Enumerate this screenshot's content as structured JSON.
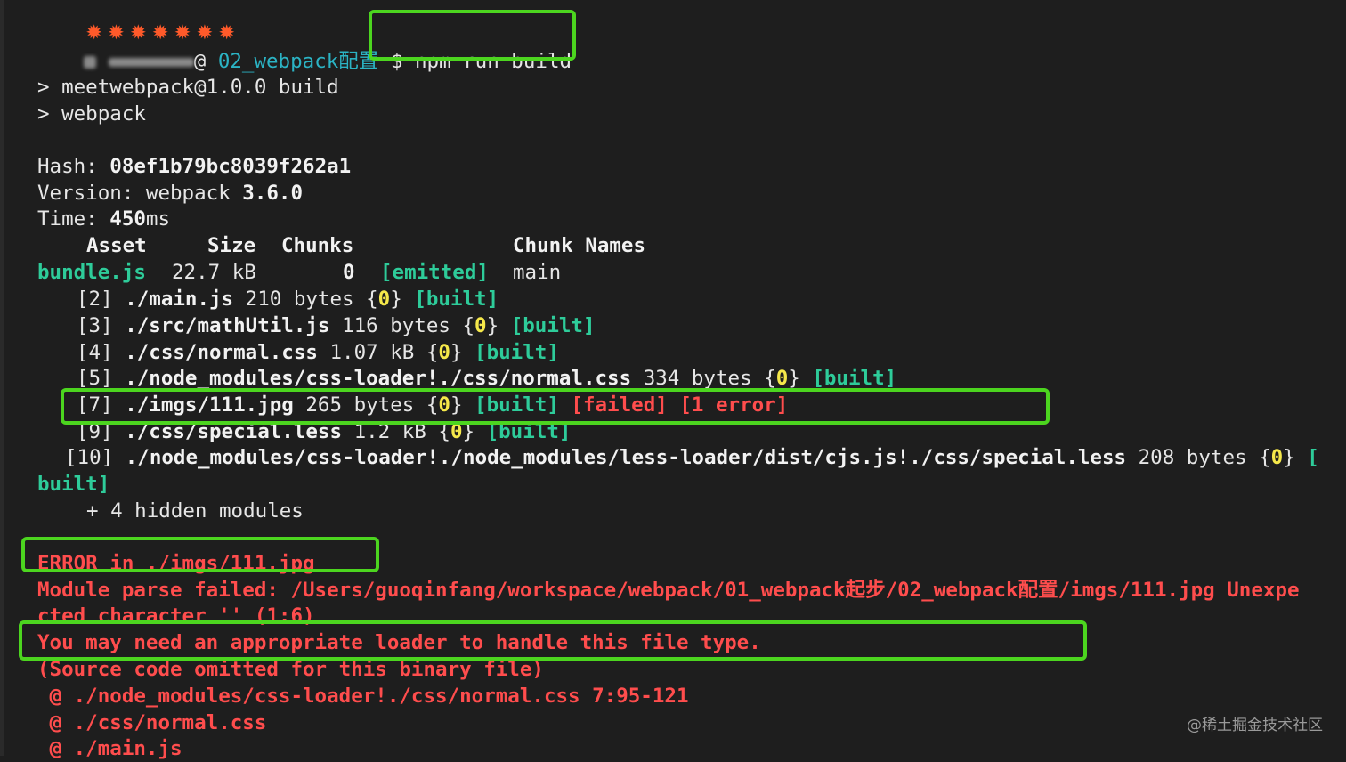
{
  "prompt": {
    "stars": "✹✹✹✹✹✹✹",
    "user_suffix": "@",
    "dir": "02_webpack配置",
    "symbol": "$",
    "command": "npm run build"
  },
  "script_lines": [
    "> meetwebpack@1.0.0 build",
    "> webpack"
  ],
  "summary": {
    "hash_label": "Hash: ",
    "hash": "08ef1b79bc8039f262a1",
    "version_label": "Version: webpack ",
    "version": "3.6.0",
    "time_label": "Time: ",
    "time": "450",
    "time_unit": "ms"
  },
  "asset_table": {
    "headers": [
      "Asset",
      "Size",
      "Chunks",
      "Chunk Names"
    ],
    "row": {
      "asset": "bundle.js",
      "size": "22.7 kB",
      "chunks": "0",
      "status": "[emitted]",
      "name": "main"
    }
  },
  "modules": [
    {
      "id": "[2]",
      "path": "./main.js",
      "size": "210 bytes",
      "chunk": "0",
      "status": "[built]"
    },
    {
      "id": "[3]",
      "path": "./src/mathUtil.js",
      "size": "116 bytes",
      "chunk": "0",
      "status": "[built]"
    },
    {
      "id": "[4]",
      "path": "./css/normal.css",
      "size": "1.07 kB",
      "chunk": "0",
      "status": "[built]"
    },
    {
      "id": "[5]",
      "path": "./node_modules/css-loader!./css/normal.css",
      "size": "334 bytes",
      "chunk": "0",
      "status": "[built]"
    },
    {
      "id": "[7]",
      "path": "./imgs/111.jpg",
      "size": "265 bytes",
      "chunk": "0",
      "status": "[built]",
      "failed": "[failed]",
      "errors": "[1 error]"
    },
    {
      "id": "[9]",
      "path": "./css/special.less",
      "size": "1.2 kB",
      "chunk": "0",
      "status": "[built]"
    },
    {
      "id": "[10]",
      "path": "./node_modules/css-loader!./node_modules/less-loader/dist/cjs.js!./css/special.less",
      "size": "208 bytes",
      "chunk": "0",
      "status_part1": "[",
      "status_part2": "built]"
    }
  ],
  "hidden_modules": "+ 4 hidden modules",
  "error": {
    "title": "ERROR in ./imgs/111.jpg",
    "line1": "Module parse failed: /Users/guoqinfang/workspace/webpack/01_webpack起步/02_webpack配置/imgs/111.jpg Unexpe",
    "line2": "cted character '' (1:6)",
    "line3": "You may need an appropriate loader to handle this file type.",
    "line4": "(Source code omitted for this binary file)",
    "trace": [
      " @ ./node_modules/css-loader!./css/normal.css 7:95-121",
      " @ ./css/normal.css",
      " @ ./main.js"
    ]
  },
  "watermark": "@稀土掘金技术社区",
  "colors": {
    "background": "#1e1e1e",
    "highlight_box": "#4cd51f",
    "error": "#ff4d4d",
    "success": "#2ecc9a",
    "chunk_id": "#f5e84a",
    "path": "#2bb3c4"
  }
}
